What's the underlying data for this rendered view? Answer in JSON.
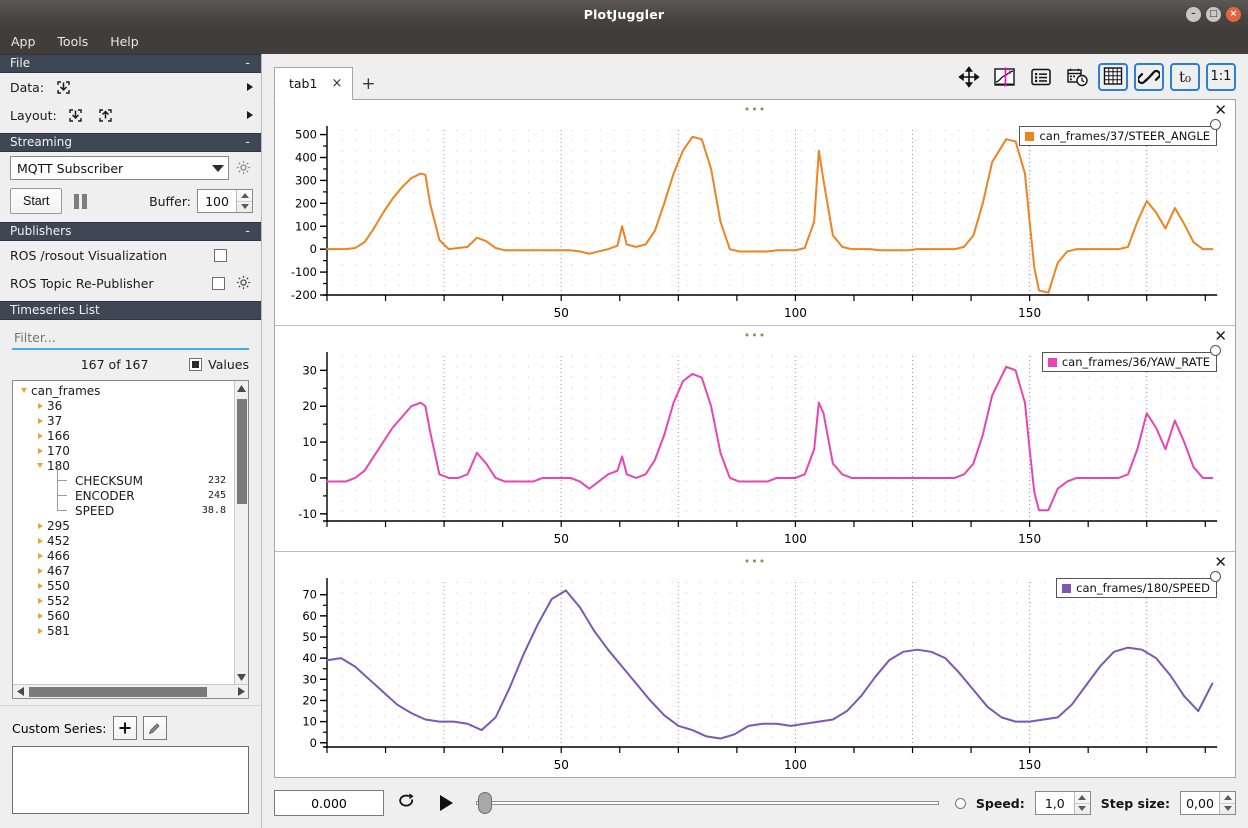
{
  "window": {
    "title": "PlotJuggler",
    "buttons": {
      "minimize": "–",
      "maximize": "□",
      "close": "×"
    }
  },
  "menubar": {
    "items": [
      "App",
      "Tools",
      "Help"
    ]
  },
  "sidebar": {
    "file": {
      "title": "File",
      "collapse": "-",
      "data_label": "Data:",
      "layout_label": "Layout:",
      "icons": [
        "load-data-icon",
        "load-layout-icon",
        "save-layout-icon"
      ]
    },
    "streaming": {
      "title": "Streaming",
      "collapse": "-",
      "selected_source": "MQTT Subscriber",
      "options": [
        "MQTT Subscriber"
      ],
      "start_label": "Start",
      "buffer_label": "Buffer:",
      "buffer_value": "100"
    },
    "publishers": {
      "title": "Publishers",
      "collapse": "-",
      "items": [
        {
          "label": "ROS /rosout Visualization",
          "checked": false,
          "has_gear": false
        },
        {
          "label": "ROS Topic Re-Publisher",
          "checked": false,
          "has_gear": true
        }
      ]
    },
    "timeseries": {
      "title": "Timeseries List",
      "filter_placeholder": "Filter...",
      "filter_value": "",
      "count_text": "167 of 167",
      "values_label": "Values",
      "values_checked": true,
      "tree": [
        {
          "depth": 0,
          "label": "can_frames",
          "state": "open",
          "value": ""
        },
        {
          "depth": 1,
          "label": "36",
          "state": "closed",
          "value": ""
        },
        {
          "depth": 1,
          "label": "37",
          "state": "closed",
          "value": ""
        },
        {
          "depth": 1,
          "label": "166",
          "state": "closed",
          "value": ""
        },
        {
          "depth": 1,
          "label": "170",
          "state": "closed",
          "value": ""
        },
        {
          "depth": 1,
          "label": "180",
          "state": "open",
          "value": ""
        },
        {
          "depth": 2,
          "label": "CHECKSUM",
          "state": "leaf",
          "value": "232"
        },
        {
          "depth": 2,
          "label": "ENCODER",
          "state": "leaf",
          "value": "245"
        },
        {
          "depth": 2,
          "label": "SPEED",
          "state": "leaf-last",
          "value": "38.8"
        },
        {
          "depth": 1,
          "label": "295",
          "state": "closed",
          "value": ""
        },
        {
          "depth": 1,
          "label": "452",
          "state": "closed",
          "value": ""
        },
        {
          "depth": 1,
          "label": "466",
          "state": "closed",
          "value": ""
        },
        {
          "depth": 1,
          "label": "467",
          "state": "closed",
          "value": ""
        },
        {
          "depth": 1,
          "label": "550",
          "state": "closed",
          "value": ""
        },
        {
          "depth": 1,
          "label": "552",
          "state": "closed",
          "value": ""
        },
        {
          "depth": 1,
          "label": "560",
          "state": "closed",
          "value": ""
        },
        {
          "depth": 1,
          "label": "581",
          "state": "closed",
          "value": ""
        }
      ]
    },
    "custom_series": {
      "label": "Custom Series:",
      "add_label": "+",
      "edit_label": "✎",
      "items": []
    }
  },
  "tabs": {
    "items": [
      {
        "label": "tab1",
        "close": "×",
        "active": true
      }
    ],
    "add_label": "+"
  },
  "toolbar": {
    "buttons": [
      {
        "name": "pan-zoom-icon",
        "active": false
      },
      {
        "name": "tracker-marker-icon",
        "active": false
      },
      {
        "name": "curve-list-icon",
        "active": false
      },
      {
        "name": "date-time-icon",
        "active": false
      },
      {
        "name": "grid-toggle-icon",
        "active": true
      },
      {
        "name": "link-axes-icon",
        "active": true
      },
      {
        "name": "time-offset-icon",
        "active": true,
        "label": "t₀"
      },
      {
        "name": "aspect-ratio-icon",
        "active": true,
        "label": "1:1"
      }
    ]
  },
  "plots": [
    {
      "dots": "•••",
      "close": "✕",
      "legend": "can_frames/37/STEER_ANGLE",
      "color": "#ee8322"
    },
    {
      "dots": "•••",
      "close": "✕",
      "legend": "can_frames/36/YAW_RATE",
      "color": "#e646b4"
    },
    {
      "dots": "•••",
      "close": "✕",
      "legend": "can_frames/180/SPEED",
      "color": "#7b57b8"
    }
  ],
  "playback": {
    "time_value": "0.000",
    "loop_label": "loop-icon",
    "play_label": "play-icon",
    "slider_position": 0,
    "speed_label": "Speed:",
    "speed_value": "1,0",
    "step_label": "Step size:",
    "step_value": "0,00"
  },
  "chart_data": [
    {
      "type": "line",
      "title": "can_frames/37/STEER_ANGLE",
      "xlabel": "",
      "ylabel": "",
      "xlim": [
        0,
        190
      ],
      "ylim": [
        -200,
        520
      ],
      "xticks": [
        50,
        100,
        150
      ],
      "yticks": [
        -200,
        -100,
        0,
        100,
        200,
        300,
        400,
        500
      ],
      "grid": true,
      "legend_position": "top-right",
      "series": [
        {
          "name": "can_frames/37/STEER_ANGLE",
          "color": "#ee8322",
          "x": [
            0,
            2,
            4,
            6,
            8,
            10,
            12,
            14,
            16,
            18,
            20,
            21,
            22,
            24,
            26,
            28,
            30,
            32,
            34,
            36,
            38,
            40,
            42,
            44,
            46,
            48,
            50,
            52,
            54,
            56,
            58,
            60,
            62,
            63,
            64,
            66,
            68,
            70,
            72,
            74,
            76,
            78,
            80,
            82,
            84,
            86,
            88,
            90,
            92,
            94,
            96,
            98,
            100,
            102,
            104,
            105,
            106,
            108,
            110,
            112,
            114,
            116,
            118,
            120,
            122,
            124,
            126,
            128,
            130,
            132,
            134,
            136,
            138,
            140,
            142,
            145,
            147,
            149,
            150,
            151,
            152,
            154,
            156,
            158,
            160,
            161,
            163,
            165,
            167,
            169,
            171,
            173,
            175,
            177,
            179,
            181,
            183,
            185,
            187,
            189
          ],
          "y": [
            0,
            0,
            0,
            5,
            30,
            90,
            160,
            220,
            270,
            310,
            330,
            325,
            200,
            40,
            0,
            5,
            10,
            50,
            35,
            5,
            -5,
            -5,
            -5,
            -5,
            -5,
            -5,
            -5,
            -5,
            -10,
            -20,
            -10,
            0,
            15,
            100,
            20,
            10,
            20,
            80,
            200,
            330,
            430,
            490,
            480,
            350,
            120,
            0,
            -10,
            -10,
            -10,
            -10,
            -5,
            -5,
            -5,
            5,
            120,
            430,
            300,
            60,
            10,
            0,
            0,
            0,
            -5,
            -5,
            -5,
            -5,
            0,
            0,
            0,
            0,
            0,
            10,
            60,
            200,
            380,
            480,
            470,
            330,
            120,
            -80,
            -180,
            -190,
            -60,
            -10,
            0,
            0,
            0,
            0,
            0,
            0,
            10,
            120,
            210,
            160,
            90,
            180,
            110,
            30,
            0,
            0
          ]
        }
      ]
    },
    {
      "type": "line",
      "title": "can_frames/36/YAW_RATE",
      "xlabel": "",
      "ylabel": "",
      "xlim": [
        0,
        190
      ],
      "ylim": [
        -12,
        34
      ],
      "xticks": [
        50,
        100,
        150
      ],
      "yticks": [
        -10,
        0,
        10,
        20,
        30
      ],
      "grid": true,
      "legend_position": "top-right",
      "series": [
        {
          "name": "can_frames/36/YAW_RATE",
          "color": "#e646b4",
          "x": [
            0,
            2,
            4,
            6,
            8,
            10,
            12,
            14,
            16,
            18,
            20,
            21,
            22,
            24,
            26,
            28,
            30,
            32,
            34,
            36,
            38,
            40,
            42,
            44,
            46,
            48,
            50,
            52,
            54,
            56,
            58,
            60,
            62,
            63,
            64,
            66,
            68,
            70,
            72,
            74,
            76,
            78,
            80,
            82,
            84,
            86,
            88,
            90,
            92,
            94,
            96,
            98,
            100,
            102,
            104,
            105,
            106,
            108,
            110,
            112,
            114,
            116,
            118,
            120,
            122,
            124,
            126,
            128,
            130,
            132,
            134,
            136,
            138,
            140,
            142,
            145,
            147,
            149,
            150,
            151,
            152,
            154,
            156,
            158,
            160,
            161,
            163,
            165,
            167,
            169,
            171,
            173,
            175,
            177,
            179,
            181,
            183,
            185,
            187,
            189
          ],
          "y": [
            -1,
            -1,
            -1,
            0,
            2,
            6,
            10,
            14,
            17,
            20,
            21,
            20,
            13,
            1,
            0,
            0,
            1,
            7,
            4,
            0,
            -1,
            -1,
            -1,
            -1,
            0,
            0,
            0,
            0,
            -1,
            -3,
            -1,
            1,
            2,
            6,
            1,
            0,
            1,
            5,
            12,
            21,
            27,
            29,
            28,
            20,
            7,
            0,
            -1,
            -1,
            -1,
            -1,
            0,
            0,
            0,
            1,
            8,
            21,
            18,
            4,
            1,
            0,
            0,
            0,
            0,
            0,
            0,
            0,
            0,
            0,
            0,
            0,
            0,
            1,
            4,
            12,
            23,
            31,
            30,
            21,
            8,
            -4,
            -9,
            -9,
            -3,
            -1,
            0,
            0,
            0,
            0,
            0,
            0,
            1,
            8,
            18,
            14,
            8,
            16,
            10,
            3,
            0,
            0
          ]
        }
      ]
    },
    {
      "type": "line",
      "title": "can_frames/180/SPEED",
      "xlabel": "",
      "ylabel": "",
      "xlim": [
        0,
        190
      ],
      "ylim": [
        -2,
        76
      ],
      "xticks": [
        50,
        100,
        150
      ],
      "yticks": [
        0,
        10,
        20,
        30,
        40,
        50,
        60,
        70
      ],
      "grid": true,
      "legend_position": "top-right",
      "series": [
        {
          "name": "can_frames/180/SPEED",
          "color": "#7b57b8",
          "x": [
            0,
            3,
            6,
            9,
            12,
            15,
            18,
            21,
            24,
            27,
            30,
            33,
            36,
            39,
            42,
            45,
            48,
            51,
            54,
            57,
            60,
            63,
            66,
            69,
            72,
            75,
            78,
            81,
            84,
            87,
            90,
            93,
            96,
            99,
            102,
            105,
            108,
            111,
            114,
            117,
            120,
            123,
            126,
            129,
            132,
            135,
            138,
            141,
            144,
            147,
            150,
            153,
            156,
            159,
            162,
            165,
            168,
            171,
            174,
            177,
            180,
            183,
            186,
            189
          ],
          "y": [
            39,
            40,
            36,
            30,
            24,
            18,
            14,
            11,
            10,
            10,
            9,
            6,
            12,
            26,
            42,
            56,
            68,
            72,
            64,
            53,
            44,
            36,
            28,
            20,
            13,
            8,
            6,
            3,
            2,
            4,
            8,
            9,
            9,
            8,
            9,
            10,
            11,
            15,
            22,
            31,
            39,
            43,
            44,
            43,
            40,
            33,
            25,
            17,
            12,
            10,
            10,
            11,
            12,
            18,
            27,
            36,
            43,
            45,
            44,
            40,
            32,
            22,
            15,
            28
          ]
        }
      ]
    }
  ]
}
